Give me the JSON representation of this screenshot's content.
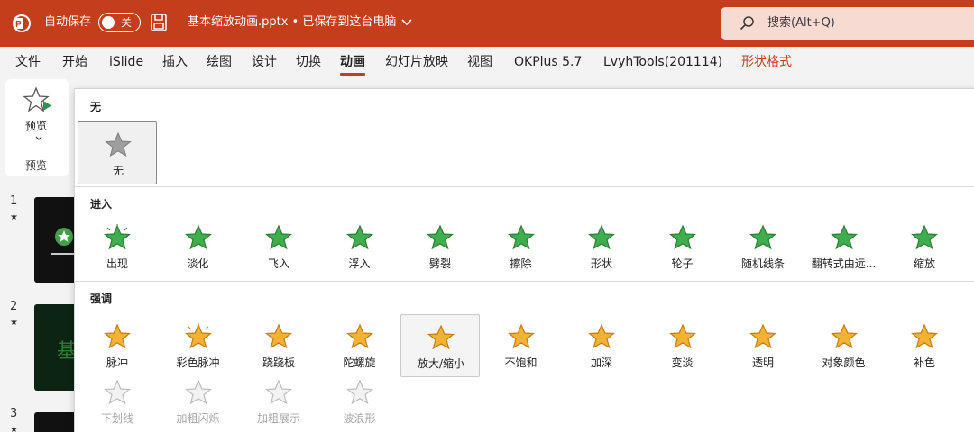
{
  "titlebar": {
    "autosave_label": "自动保存",
    "autosave_state": "关",
    "document_title": "基本缩放动画.pptx • 已保存到这台电脑",
    "search_placeholder": "搜索(Alt+Q)"
  },
  "menu_tabs": [
    {
      "label": "文件"
    },
    {
      "label": "开始"
    },
    {
      "label": "iSlide"
    },
    {
      "label": "插入"
    },
    {
      "label": "绘图"
    },
    {
      "label": "设计"
    },
    {
      "label": "切换"
    },
    {
      "label": "动画",
      "active": true
    },
    {
      "label": "幻灯片放映"
    },
    {
      "label": "视图"
    },
    {
      "label": "OKPlus 5.7"
    },
    {
      "label": "LvyhTools(201114)"
    },
    {
      "label": "形状格式",
      "contextual": true
    }
  ],
  "ribbon": {
    "preview_button": "预览",
    "preview_group": "预览"
  },
  "thumbnails": [
    {
      "number": "1",
      "marker": "★"
    },
    {
      "number": "2",
      "marker": "★",
      "text": "基"
    },
    {
      "number": "3",
      "marker": "★"
    }
  ],
  "gallery": {
    "none_section": {
      "title": "无",
      "items": [
        {
          "label": "无",
          "icon": "star-gray-icon",
          "selected": true
        }
      ]
    },
    "entrance_section": {
      "title": "进入",
      "color": "#3fae4e",
      "items": [
        {
          "label": "出现",
          "icon": "appear-star-icon"
        },
        {
          "label": "淡化",
          "icon": "fade-star-icon"
        },
        {
          "label": "飞入",
          "icon": "fly-in-star-icon"
        },
        {
          "label": "浮入",
          "icon": "float-in-star-icon"
        },
        {
          "label": "劈裂",
          "icon": "split-star-icon"
        },
        {
          "label": "擦除",
          "icon": "wipe-star-icon"
        },
        {
          "label": "形状",
          "icon": "shape-star-icon"
        },
        {
          "label": "轮子",
          "icon": "wheel-star-icon"
        },
        {
          "label": "随机线条",
          "icon": "random-bars-star-icon"
        },
        {
          "label": "翻转式由远...",
          "icon": "grow-turn-star-icon"
        },
        {
          "label": "缩放",
          "icon": "zoom-star-icon"
        }
      ]
    },
    "emphasis_section": {
      "title": "强调",
      "color": "#f2b233",
      "items": [
        {
          "label": "脉冲",
          "icon": "pulse-star-icon"
        },
        {
          "label": "彩色脉冲",
          "icon": "color-pulse-star-icon"
        },
        {
          "label": "跷跷板",
          "icon": "teeter-star-icon"
        },
        {
          "label": "陀螺旋",
          "icon": "spin-star-icon"
        },
        {
          "label": "放大/缩小",
          "icon": "grow-shrink-star-icon",
          "hover": true
        },
        {
          "label": "不饱和",
          "icon": "desaturate-star-icon"
        },
        {
          "label": "加深",
          "icon": "darken-star-icon"
        },
        {
          "label": "变淡",
          "icon": "lighten-star-icon"
        },
        {
          "label": "透明",
          "icon": "transparency-star-icon"
        },
        {
          "label": "对象颜色",
          "icon": "object-color-star-icon"
        },
        {
          "label": "补色",
          "icon": "complementary-color-star-icon"
        }
      ],
      "disabled_items": [
        {
          "label": "下划线",
          "icon": "underline-star-icon"
        },
        {
          "label": "加粗闪烁",
          "icon": "bold-flash-star-icon"
        },
        {
          "label": "加粗展示",
          "icon": "bold-reveal-star-icon"
        },
        {
          "label": "波浪形",
          "icon": "wave-star-icon"
        }
      ]
    }
  }
}
